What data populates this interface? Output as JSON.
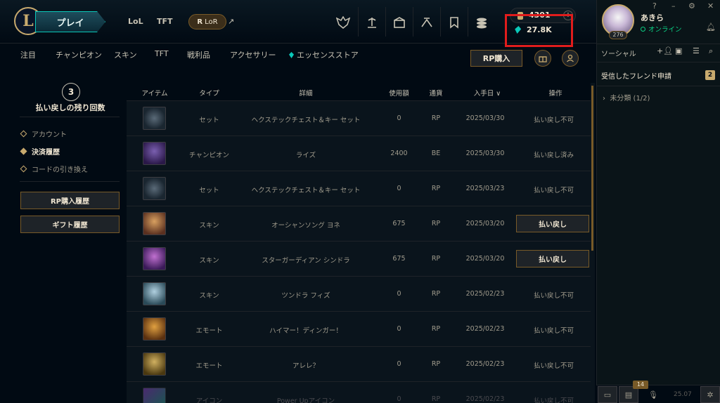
{
  "topbar": {
    "play_label": "プレイ",
    "game_tabs": [
      "LoL",
      "TFT"
    ],
    "lor_label": "LoR",
    "rp_amount": "4301",
    "be_amount": "27.8K"
  },
  "subnav": {
    "items": [
      "注目",
      "チャンピオン",
      "スキン",
      "TFT",
      "戦利品",
      "アクセサリー",
      "エッセンスストア"
    ],
    "rp_buy_label": "RP購入"
  },
  "left_panel": {
    "refund_count": "3",
    "refund_label": "払い戻しの残り回数",
    "links": [
      "アカウント",
      "決済履歴",
      "コードの引き換え"
    ],
    "active_link": "決済履歴",
    "buttons": [
      "RP購入履歴",
      "ギフト履歴"
    ]
  },
  "table": {
    "headers": [
      "アイテム",
      "タイプ",
      "詳細",
      "使用額",
      "通貨",
      "入手日",
      "操作"
    ],
    "rows": [
      {
        "type": "セット",
        "detail": "ヘクステックチェスト＆キー セット",
        "amount": "0",
        "currency": "RP",
        "date": "2025/03/30",
        "action": "払い戻し不可",
        "refundable": false
      },
      {
        "type": "チャンピオン",
        "detail": "ライズ",
        "amount": "2400",
        "currency": "BE",
        "date": "2025/03/30",
        "action": "払い戻し済み",
        "refundable": false
      },
      {
        "type": "セット",
        "detail": "ヘクステックチェスト＆キー セット",
        "amount": "0",
        "currency": "RP",
        "date": "2025/03/23",
        "action": "払い戻し不可",
        "refundable": false
      },
      {
        "type": "スキン",
        "detail": "オーシャンソング ヨネ",
        "amount": "675",
        "currency": "RP",
        "date": "2025/03/20",
        "action": "払い戻し",
        "refundable": true
      },
      {
        "type": "スキン",
        "detail": "スターガーディアン シンドラ",
        "amount": "675",
        "currency": "RP",
        "date": "2025/03/20",
        "action": "払い戻し",
        "refundable": true
      },
      {
        "type": "スキン",
        "detail": "ツンドラ フィズ",
        "amount": "0",
        "currency": "RP",
        "date": "2025/02/23",
        "action": "払い戻し不可",
        "refundable": false
      },
      {
        "type": "エモート",
        "detail": "ハイマー！ディンガー！",
        "amount": "0",
        "currency": "RP",
        "date": "2025/02/23",
        "action": "払い戻し不可",
        "refundable": false
      },
      {
        "type": "エモート",
        "detail": "アレレ？",
        "amount": "0",
        "currency": "RP",
        "date": "2025/02/23",
        "action": "払い戻し不可",
        "refundable": false
      },
      {
        "type": "アイコン",
        "detail": "Power Upアイコン",
        "amount": "0",
        "currency": "RP",
        "date": "2025/02/23",
        "action": "払い戻し不可",
        "refundable": false
      }
    ]
  },
  "social": {
    "username": "あきら",
    "status": "オンライン",
    "level": "276",
    "title": "ソーシャル",
    "friend_requests_label": "受信したフレンド申請",
    "friend_requests_count": "2",
    "group_label": "未分類 (1/2)",
    "chat_badge": "14",
    "version": "25.07"
  },
  "colors": {
    "gold": "#c8aa6e",
    "teal": "#0ac8b9",
    "highlight": "#e01c1c",
    "online": "#0acf83"
  }
}
